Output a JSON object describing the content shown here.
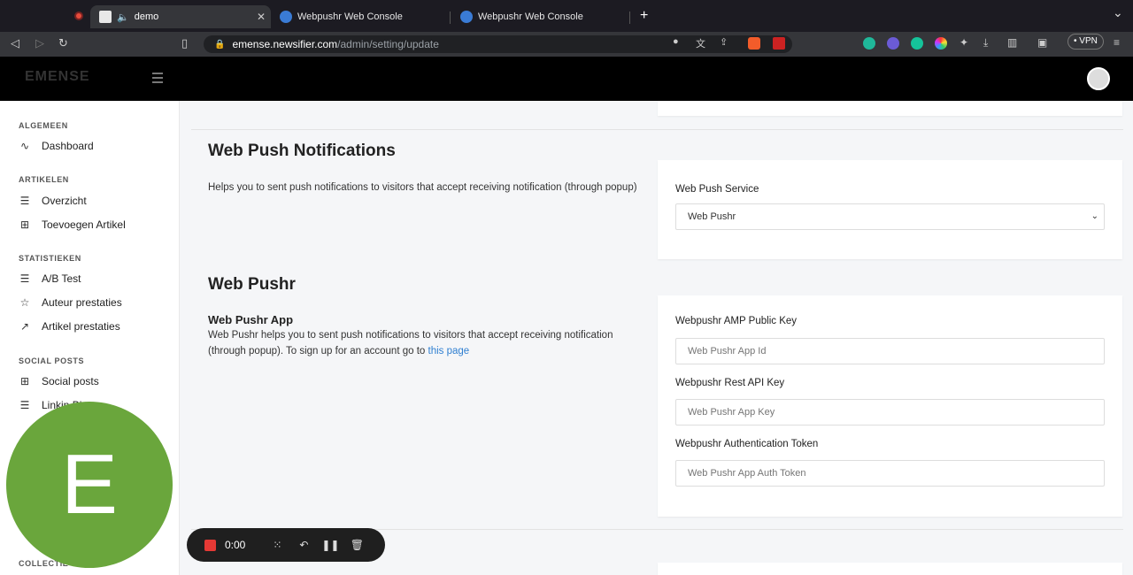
{
  "browser": {
    "tabs": [
      {
        "label": "demo",
        "active": true
      },
      {
        "label": "Webpushr Web Console",
        "active": false
      },
      {
        "label": "Webpushr Web Console",
        "active": false
      }
    ],
    "new_tab": "+",
    "url_host": "emense.newsifier.com",
    "url_path": "/admin/setting/update",
    "vpn_label": "VPN",
    "tab_close": "✕",
    "tabs_menu": "⌄"
  },
  "app": {
    "logo_text": "EMENSE"
  },
  "sidebar": {
    "sections": [
      {
        "title": "ALGEMEEN",
        "items": [
          {
            "label": "Dashboard",
            "icon": "activity-icon"
          }
        ]
      },
      {
        "title": "ARTIKELEN",
        "items": [
          {
            "label": "Overzicht",
            "icon": "list-icon"
          },
          {
            "label": "Toevoegen Artikel",
            "icon": "plus-square-icon"
          }
        ]
      },
      {
        "title": "STATISTIEKEN",
        "items": [
          {
            "label": "A/B Test",
            "icon": "list-icon"
          },
          {
            "label": "Auteur prestaties",
            "icon": "star-icon"
          },
          {
            "label": "Artikel prestaties",
            "icon": "trending-up-icon"
          }
        ]
      },
      {
        "title": "SOCIAL POSTS",
        "items": [
          {
            "label": "Social posts",
            "icon": "grid-icon"
          },
          {
            "label": "Linkin Bio",
            "icon": "list-icon"
          }
        ]
      }
    ],
    "partial_section": "COLLECTIE"
  },
  "main": {
    "web_push": {
      "title": "Web Push Notifications",
      "description": "Helps you to sent push notifications to visitors that accept receiving notification (through popup)",
      "service_label": "Web Push Service",
      "service_value": "Web Pushr"
    },
    "webpushr": {
      "title": "Web Pushr",
      "app_title": "Web Pushr App",
      "description": "Web Pushr helps you to sent push notifications to visitors that accept receiving notification (through popup). To sign up for an account go to",
      "link_text": "this page",
      "fields": [
        {
          "label": "Webpushr AMP Public Key",
          "placeholder": "Web Pushr App Id"
        },
        {
          "label": "Webpushr Rest API Key",
          "placeholder": "Web Pushr App Key"
        },
        {
          "label": "Webpushr Authentication Token",
          "placeholder": "Web Pushr App Auth Token"
        }
      ]
    }
  },
  "overlay": {
    "avatar_letter": "E",
    "recorder_time": "0:00"
  }
}
